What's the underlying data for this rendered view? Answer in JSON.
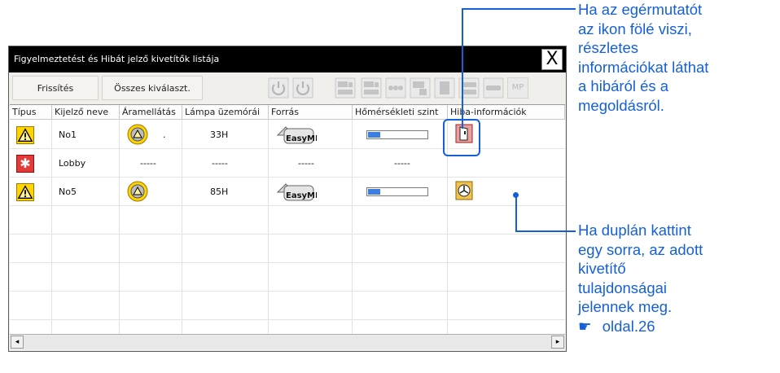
{
  "window": {
    "title": "Figyelmeztetést és Hibát jelző kivetítők listája",
    "close_label": "X"
  },
  "toolbar": {
    "refresh_label": "Frissítés",
    "select_all_label": "Összes kiválaszt.",
    "mp_label": "MP"
  },
  "table": {
    "columns": [
      "Típus",
      "Kijelző neve",
      "Áramellátás",
      "Lámpa üzemórái",
      "Forrás",
      "Hőmérsékleti szint",
      "Hiba-információk"
    ],
    "rows": [
      {
        "type_icon": "warning-icon",
        "name": "No1",
        "power": ".",
        "lamp_hours": "33H",
        "source": "EasyMP",
        "temp_level": 0.2,
        "error_icon": "error-info-door-icon"
      },
      {
        "type_icon": "error-icon",
        "name": "Lobby",
        "power": "-----",
        "lamp_hours": "-----",
        "source": "-----",
        "temp": "-----",
        "error_icon": ""
      },
      {
        "type_icon": "warning-icon",
        "name": "No5",
        "power": "",
        "lamp_hours": "85H",
        "source": "EasyMP",
        "temp_level": 0.2,
        "error_icon": "error-info-fan-icon"
      }
    ]
  },
  "scrollbar": {
    "left_arrow": "◂",
    "right_arrow": "▸"
  },
  "annotations": {
    "hover_lines": [
      "Ha az egérmutatót",
      "az ikon fölé viszi,",
      "részletes",
      "információkat láthat",
      "a hibáról és a",
      "megoldásról."
    ],
    "dblclick_lines": [
      "Ha duplán kattint",
      "egy sorra, az adott",
      "kivetítő",
      "tulajdonságai",
      "jelennek meg."
    ],
    "page_ref_icon": "☛",
    "page_ref": "oldal.26"
  },
  "colors": {
    "accent": "#1560d8",
    "warning": "#ffd400",
    "error": "#e33a3a",
    "temp_fill": "#3b7de0"
  }
}
